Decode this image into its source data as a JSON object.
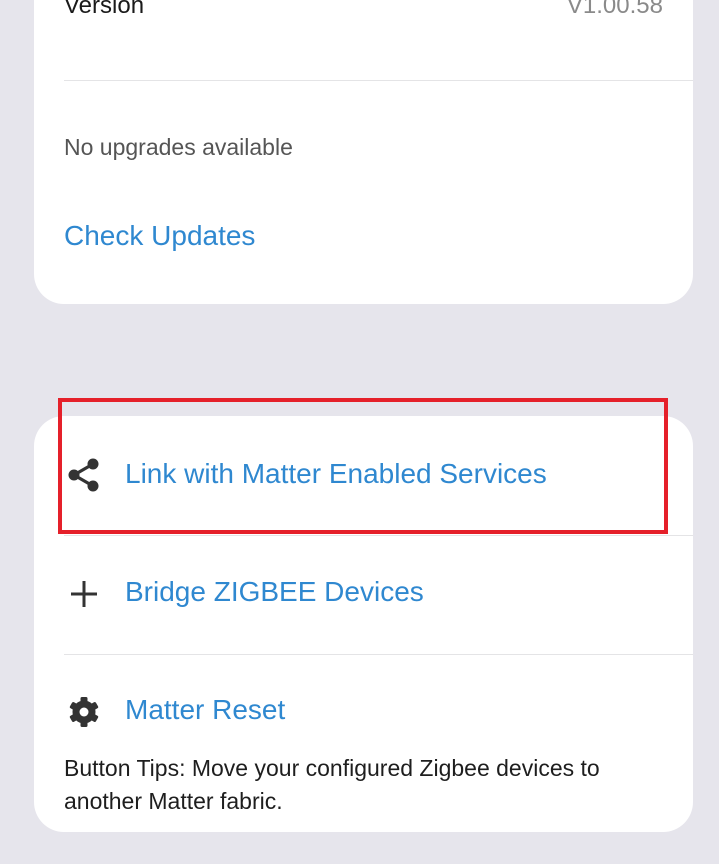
{
  "firmware": {
    "version_label": "Version",
    "version_value": "V1.00.58",
    "status": "No upgrades available",
    "check_updates_label": "Check Updates"
  },
  "matter": {
    "actions": [
      {
        "label": "Link with Matter Enabled Services",
        "icon": "share-icon"
      },
      {
        "label": "Bridge ZIGBEE Devices",
        "icon": "plus-icon"
      },
      {
        "label": "Matter Reset",
        "icon": "gear-icon"
      }
    ],
    "tip": "Button Tips: Move your configured Zigbee devices to another Matter fabric."
  },
  "colors": {
    "background": "#e6e5ec",
    "card": "#ffffff",
    "link": "#2f88d0",
    "highlight": "#e5202a",
    "icon": "#333333"
  }
}
